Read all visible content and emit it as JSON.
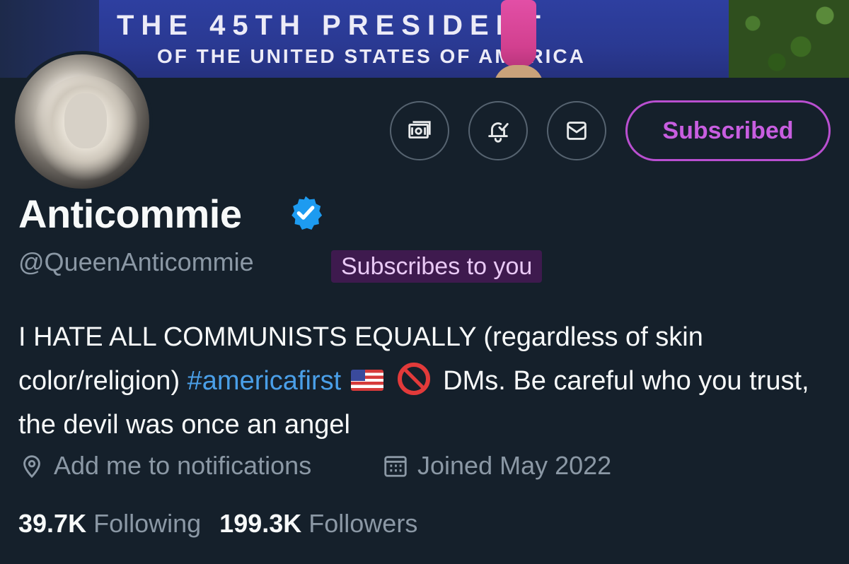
{
  "banner": {
    "line1": "THE 45TH PRESIDENT",
    "line2": "OF THE UNITED STATES OF AMERICA"
  },
  "actions": {
    "subscribed_label": "Subscribed",
    "icons": [
      "money-icon",
      "notification-bell-icon",
      "mail-icon"
    ]
  },
  "profile": {
    "name": "Anticommie",
    "handle": "@QueenAnticommie",
    "subscribes_badge": "Subscribes to you"
  },
  "bio": {
    "part1": "I HATE ALL COMMUNISTS EQUALLY (regardless of skin color/religion) ",
    "hashtag": "#americafirst",
    "part2": "DMs. Be careful who you trust, the devil was once an angel"
  },
  "meta": {
    "location": "Add me to notifications",
    "joined": "Joined May 2022"
  },
  "stats": {
    "following_count": "39.7K",
    "following_label": "Following",
    "followers_count": "199.3K",
    "followers_label": "Followers"
  },
  "colors": {
    "background": "#15202b",
    "accent_purple": "#c85ee0",
    "hashtag_blue": "#4a9fe8",
    "verified_blue": "#1d9bf0",
    "muted_text": "#8b98a5"
  }
}
